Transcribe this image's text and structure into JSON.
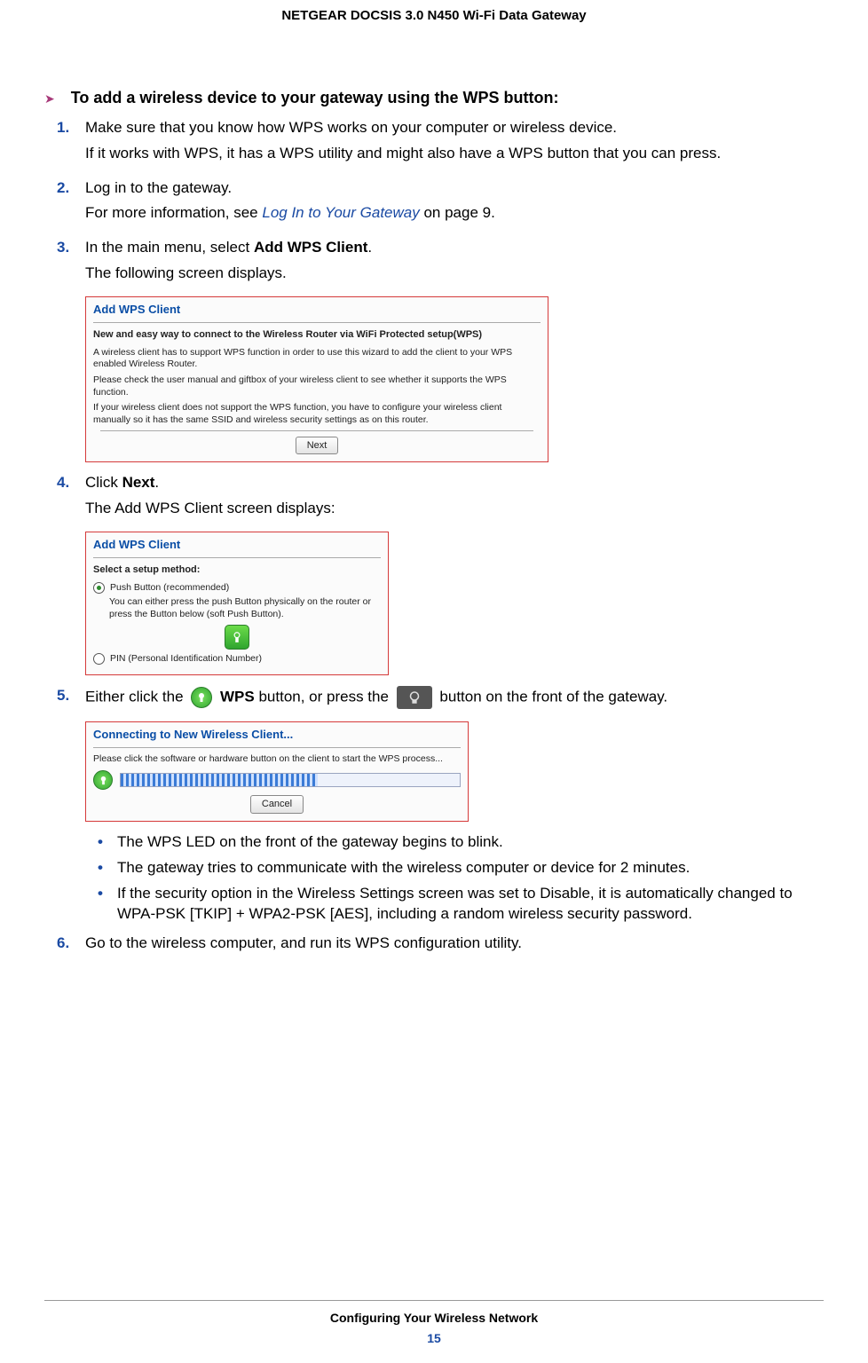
{
  "header": {
    "title": "NETGEAR DOCSIS 3.0 N450 Wi-Fi Data Gateway"
  },
  "heading": {
    "text": "To add a wireless device to your gateway using the WPS button:"
  },
  "steps": {
    "s1": {
      "num": "1.",
      "line1": "Make sure that you know how WPS works on your computer or wireless device.",
      "line2": "If it works with WPS, it has a WPS utility and might also have a WPS button that you can press."
    },
    "s2": {
      "num": "2.",
      "line1": "Log in to the gateway.",
      "line2a": "For more information, see ",
      "xref": "Log In to Your Gateway",
      "line2b": " on page 9."
    },
    "s3": {
      "num": "3.",
      "line1a": "In the main menu, select ",
      "bold": "Add WPS Client",
      "line1b": ".",
      "line2": "The following screen displays."
    },
    "s4": {
      "num": "4.",
      "line1a": "Click ",
      "bold": "Next",
      "line1b": ".",
      "line2": "The Add WPS Client screen displays:"
    },
    "s5": {
      "num": "5.",
      "pre": "Either click the ",
      "wpsLabelA": " ",
      "wpsBold": "WPS",
      "mid": " button, or press the ",
      "post": " button on the front of the gateway."
    },
    "s6": {
      "num": "6.",
      "text": "Go to the wireless computer, and run its WPS configuration utility."
    }
  },
  "bullets": {
    "b1": "The WPS LED on the front of the gateway begins to blink.",
    "b2": "The gateway tries to communicate with the wireless computer or device for 2 minutes.",
    "b3": "If the security option in the Wireless Settings screen was set to Disable, it is automatically changed to WPA-PSK [TKIP] + WPA2-PSK [AES], including a random wireless security password."
  },
  "shot1": {
    "title": "Add WPS Client",
    "bold": "New and easy way to connect to the Wireless Router via WiFi Protected setup(WPS)",
    "p1": "A wireless client has to support WPS function in order to use this wizard to add the client to your WPS enabled Wireless Router.",
    "p2": "Please check the user manual and giftbox of your wireless client to see whether it supports the WPS function.",
    "p3": "If your wireless client does not support the WPS function, you have to configure your wireless client manually so it has the same SSID and wireless security settings as on this router.",
    "btn": "Next"
  },
  "shot2": {
    "title": "Add WPS Client",
    "subtitle": "Select a setup method:",
    "opt1": "Push Button (recommended)",
    "opt1desc": "You can either press the push Button physically on the router or press the Button below (soft Push Button).",
    "opt2": "PIN (Personal Identification Number)"
  },
  "shot3": {
    "title": "Connecting to New Wireless Client...",
    "msg": "Please click the software or hardware button on the client to start the WPS process...",
    "btn": "Cancel"
  },
  "footer": {
    "label": "Configuring Your Wireless Network",
    "page": "15"
  }
}
